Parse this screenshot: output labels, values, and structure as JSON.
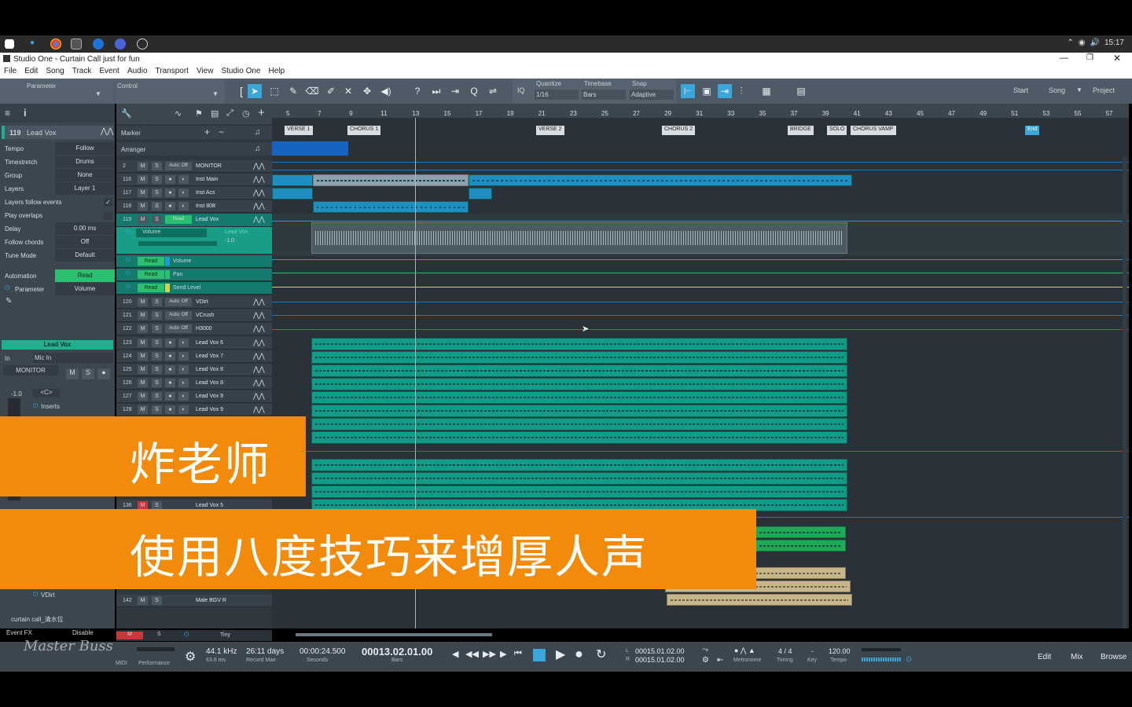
{
  "taskbar": {
    "time": "15:17"
  },
  "window": {
    "title": "Studio One - Curtain Call just for fun"
  },
  "menu": [
    "File",
    "Edit",
    "Song",
    "Track",
    "Event",
    "Audio",
    "Transport",
    "View",
    "Studio One",
    "Help"
  ],
  "toolbar": {
    "parameter_label": "Parameter",
    "control_label": "Control",
    "quantize_label": "Quantize",
    "quantize_value": "1/16",
    "timebase_label": "Timebase",
    "timebase_value": "Bars",
    "snap_label": "Snap",
    "snap_value": "Adaptive",
    "iq_label": "IQ",
    "start_label": "Start",
    "song_label": "Song",
    "project_label": "Project"
  },
  "inspector": {
    "track_num": "119",
    "track_name": "Lead Vox",
    "rows": [
      {
        "k": "Tempo",
        "v": "Follow"
      },
      {
        "k": "Timestretch",
        "v": "Drums"
      },
      {
        "k": "Group",
        "v": "None"
      },
      {
        "k": "Layers",
        "v": "Layer 1"
      },
      {
        "k": "Layers follow events",
        "v": ""
      },
      {
        "k": "Play overlaps",
        "v": ""
      },
      {
        "k": "Delay",
        "v": "0.00 ms"
      },
      {
        "k": "Follow chords",
        "v": "Off"
      },
      {
        "k": "Tune Mode",
        "v": "Default"
      }
    ],
    "automation_label": "Automation",
    "automation_value": "Read",
    "parameter_label": "Parameter",
    "parameter_value": "Volume",
    "channel_name": "Lead Vox",
    "input_label": "In",
    "input_value": "Mic In",
    "monitor_label": "MONITOR",
    "fader_value": "-1.0",
    "pan_value": "<C>",
    "inserts_label": "Inserts",
    "insert_item": "VDirt",
    "song_label": "curtain call_清水位",
    "eventfx_label": "Event FX",
    "disable_label": "Disable"
  },
  "tracklist": {
    "marker_label": "Marker",
    "arranger_label": "Arranger",
    "tracks": [
      {
        "num": "2",
        "mode": "Auto: Off",
        "name": "MONITOR"
      },
      {
        "num": "116",
        "mode": "",
        "name": "Inst Main"
      },
      {
        "num": "117",
        "mode": "",
        "name": "Inst Acs"
      },
      {
        "num": "118",
        "mode": "",
        "name": "Inst 808"
      },
      {
        "num": "119",
        "mode": "Read",
        "name": "Lead Vox"
      },
      {
        "num": "",
        "mode": "Read",
        "name": "Volume"
      },
      {
        "num": "",
        "mode": "Read",
        "name": "Pan"
      },
      {
        "num": "",
        "mode": "Read",
        "name": "Send Level"
      },
      {
        "num": "120",
        "mode": "Auto: Off",
        "name": "VDirt"
      },
      {
        "num": "121",
        "mode": "Auto: Off",
        "name": "VCrush"
      },
      {
        "num": "122",
        "mode": "Auto: Off",
        "name": "H3000"
      },
      {
        "num": "123",
        "mode": "",
        "name": "Lead Vox 6"
      },
      {
        "num": "124",
        "mode": "",
        "name": "Lead Vox 7"
      },
      {
        "num": "125",
        "mode": "",
        "name": "Lead Vox 8"
      },
      {
        "num": "126",
        "mode": "",
        "name": "Lead Vox 8"
      },
      {
        "num": "127",
        "mode": "",
        "name": "Lead Vox 9"
      },
      {
        "num": "128",
        "mode": "",
        "name": "Lead Vox 9"
      }
    ],
    "lead_vox_volume_label": "Volume",
    "lead_vox_sub": "Lead Vox",
    "lead_vox_value": "-1.0",
    "track_136": {
      "num": "136",
      "name": "Lead Vox 5"
    },
    "track_142": {
      "num": "142",
      "name": "Male BGV R"
    },
    "footer_m": "M",
    "footer_s": "S",
    "footer_size": "Tiny"
  },
  "ruler": [
    "5",
    "7",
    "9",
    "11",
    "13",
    "15",
    "17",
    "19",
    "21",
    "23",
    "25",
    "27",
    "29",
    "31",
    "33",
    "35",
    "37",
    "39",
    "41",
    "43",
    "45",
    "47",
    "49",
    "51",
    "53",
    "55",
    "57"
  ],
  "markers": [
    "VERSE 1",
    "CHORUS 1",
    "VERSE 2",
    "CHORUS 2",
    "BRIDGE",
    "SOLO",
    "CHORUS VAMP",
    "End"
  ],
  "transport": {
    "midi_label": "MIDI",
    "performance_label": "Performance",
    "sample_rate": "44.1 kHz",
    "latency": "63.6 ms",
    "record_days": "26:11 days",
    "record_max_label": "Record Max",
    "seconds_value": "00:00:24.500",
    "seconds_label": "Seconds",
    "bars_value": "00013.02.01.00",
    "bars_label": "Bars",
    "loop_l": "00015.01.02.00",
    "loop_r": "00015.01.02.00",
    "l_label": "L",
    "r_label": "R",
    "metronome_label": "Metronome",
    "timing_value": "4 / 4",
    "timing_label": "Timing",
    "key_value": "-",
    "key_label": "Key",
    "tempo_value": "120.00",
    "tempo_label": "Tempo",
    "edit_label": "Edit",
    "mix_label": "Mix",
    "browse_label": "Browse"
  },
  "overlay": {
    "title": "炸老师",
    "subtitle": "使用八度技巧来增厚人声"
  },
  "watermark": "Master Buss",
  "colors": {
    "accent": "#3aa6d9",
    "teal": "#129b86",
    "orange": "#f28b0b",
    "tan": "#c6b68a"
  }
}
